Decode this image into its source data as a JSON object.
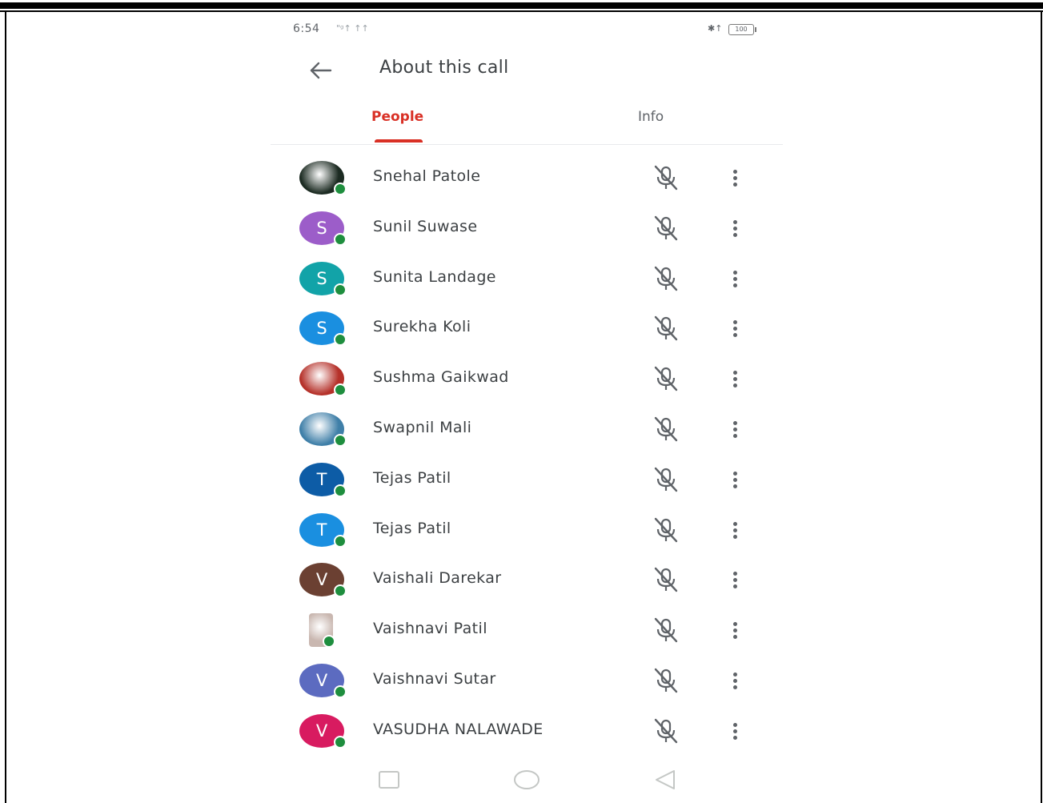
{
  "statusbar": {
    "time": "6:54",
    "signal": "\"ᵍ↑ ↑↑",
    "right_icons": "✱↑",
    "battery": "100"
  },
  "header": {
    "back_icon": "arrow-left-icon",
    "title": "About this call"
  },
  "tabs": [
    {
      "label": "People",
      "active": true
    },
    {
      "label": "Info",
      "active": false
    }
  ],
  "colors": {
    "accent": "#d93025",
    "presence": "#1e8e3e",
    "text": "#3c4043",
    "icon": "#5f6368"
  },
  "participants": [
    {
      "name": "Snehal Patole",
      "avatar": {
        "type": "photo",
        "bg": "#1c2b22"
      }
    },
    {
      "name": "Sunil Suwase",
      "avatar": {
        "type": "initial",
        "initial": "S",
        "bg": "#9c5dc9"
      }
    },
    {
      "name": "Sunita Landage",
      "avatar": {
        "type": "initial",
        "initial": "S",
        "bg": "#12a3a8"
      }
    },
    {
      "name": "Surekha Koli",
      "avatar": {
        "type": "initial",
        "initial": "S",
        "bg": "#1a8fe0"
      }
    },
    {
      "name": "Sushma Gaikwad",
      "avatar": {
        "type": "photo",
        "bg": "#b5312a"
      }
    },
    {
      "name": "Swapnil Mali",
      "avatar": {
        "type": "photo",
        "bg": "#3f7fa8"
      }
    },
    {
      "name": "Tejas Patil",
      "avatar": {
        "type": "initial",
        "initial": "T",
        "bg": "#0d5ca6"
      }
    },
    {
      "name": "Tejas Patil",
      "avatar": {
        "type": "initial",
        "initial": "T",
        "bg": "#1a8fe0"
      }
    },
    {
      "name": "Vaishali Darekar",
      "avatar": {
        "type": "initial",
        "initial": "V",
        "bg": "#6b4032"
      }
    },
    {
      "name": "Vaishnavi Patil",
      "avatar": {
        "type": "photo-square",
        "bg": "#c9b7b0"
      }
    },
    {
      "name": "Vaishnavi Sutar",
      "avatar": {
        "type": "initial",
        "initial": "V",
        "bg": "#5c6bc0"
      }
    },
    {
      "name": "VASUDHA NALAWADE",
      "avatar": {
        "type": "initial",
        "initial": "V",
        "bg": "#d81b60"
      }
    }
  ],
  "row_icons": {
    "mic": "mic-off-icon",
    "more": "more-vertical-icon"
  },
  "navbar": [
    "recents-icon",
    "home-icon",
    "back-triangle-icon"
  ]
}
